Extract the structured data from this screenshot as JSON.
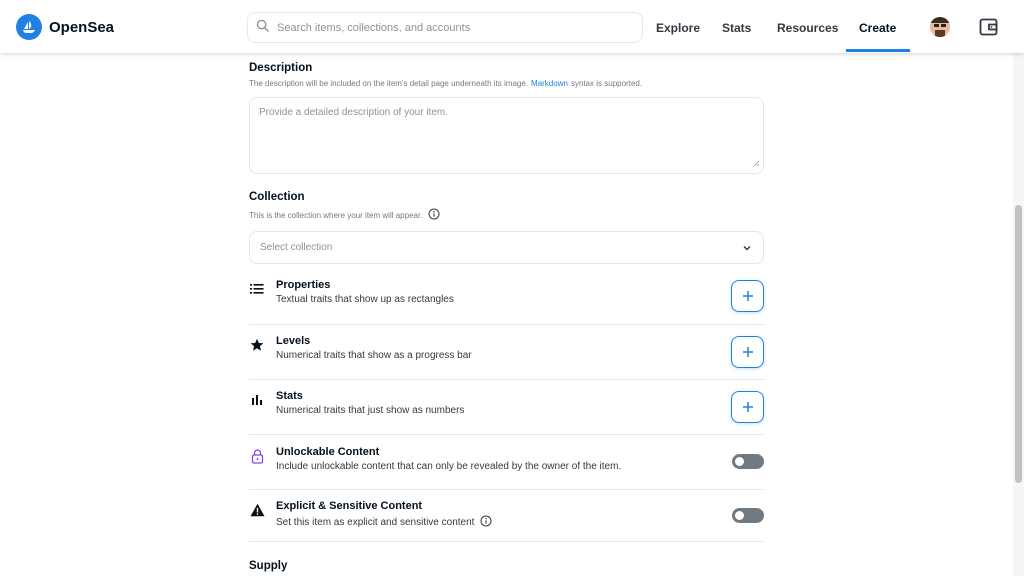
{
  "header": {
    "brand": "OpenSea",
    "search_placeholder": "Search items, collections, and accounts",
    "nav": [
      {
        "label": "Explore"
      },
      {
        "label": "Stats"
      },
      {
        "label": "Resources"
      },
      {
        "label": "Create",
        "active": true
      }
    ]
  },
  "description": {
    "label": "Description",
    "help_before": "The description will be included on the item's detail page underneath its image.",
    "help_link": "Markdown",
    "help_after": "syntax is supported.",
    "placeholder": "Provide a detailed description of your item."
  },
  "collection": {
    "label": "Collection",
    "help": "This is the collection where your item will appear.",
    "select_placeholder": "Select collection"
  },
  "traits": [
    {
      "icon": "list-icon",
      "title": "Properties",
      "desc": "Textual traits that show up as rectangles"
    },
    {
      "icon": "star-icon",
      "title": "Levels",
      "desc": "Numerical traits that show as a progress bar"
    },
    {
      "icon": "bar-chart-icon",
      "title": "Stats",
      "desc": "Numerical traits that just show as numbers"
    }
  ],
  "toggles": [
    {
      "icon": "lock-icon",
      "title": "Unlockable Content",
      "desc": "Include unlockable content that can only be revealed by the owner of the item.",
      "on": false
    },
    {
      "icon": "warning-icon",
      "title": "Explicit & Sensitive Content",
      "desc": "Set this item as explicit and sensitive content",
      "on": false
    }
  ],
  "supply": {
    "label": "Supply"
  },
  "colors": {
    "accent": "#2081e2",
    "text": "#04111d",
    "muted": "#707a83",
    "border": "#e5e8eb",
    "toggle_off": "#707a83"
  }
}
